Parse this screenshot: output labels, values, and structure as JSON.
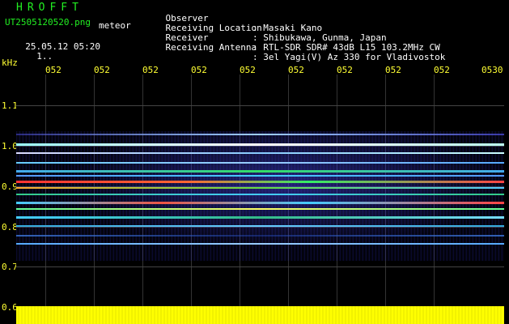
{
  "header": {
    "brand": "HROFFT",
    "filename": "UT2505120520.png",
    "tag": "meteor",
    "datetime": "25.05.12 05:20",
    "extra": "1.."
  },
  "info": [
    {
      "label": "Observer",
      "value": ": Masaki Kano"
    },
    {
      "label": "Receiving Location",
      "value": ": Shibukawa, Gunma, Japan"
    },
    {
      "label": "Receiver",
      "value": ": RTL-SDR SDR# 43dB L15 103.2MHz CW"
    },
    {
      "label": "Receiving Antenna",
      "value": ": 3el Yagi(V) Az 330 for Vladivostok"
    }
  ],
  "axis": {
    "unit": "kHz",
    "x_ticks": [
      "052",
      "052",
      "052",
      "052",
      "052",
      "052",
      "052",
      "052",
      "052",
      "0530"
    ],
    "y_ticks": [
      "1.1",
      "1.0",
      "0.9",
      "0.8",
      "0.7",
      "0.6"
    ]
  },
  "colors": {
    "axis_text": "#ffff33",
    "brand": "#22ee22",
    "amplitude": "#ffff00"
  }
}
